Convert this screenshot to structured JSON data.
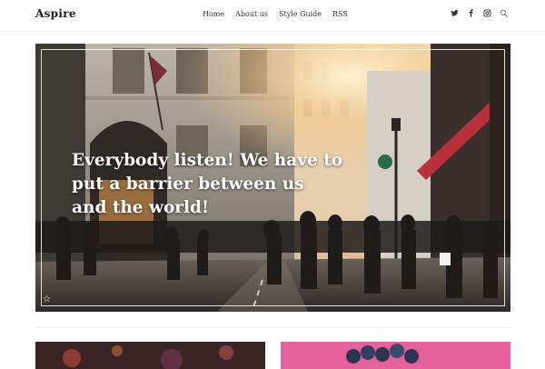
{
  "site": {
    "logo": "Aspire"
  },
  "nav": {
    "items": [
      "Home",
      "About us",
      "Style Guide",
      "RSS"
    ]
  },
  "social": {
    "icons": [
      "twitter-icon",
      "facebook-icon",
      "instagram-icon",
      "search-icon"
    ]
  },
  "hero": {
    "headline": "Everybody listen! We have to put a barrier between us and the world!",
    "favorite_icon": "☆"
  },
  "colors": {
    "accent_card_left": "#3b2426",
    "accent_card_right": "#e6619b",
    "awning_red": "#b8303a"
  }
}
